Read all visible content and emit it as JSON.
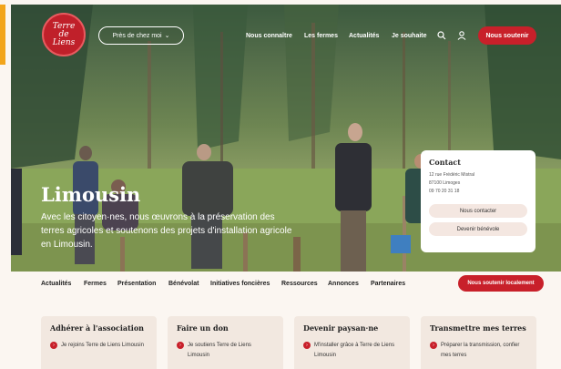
{
  "brand": {
    "logo_line1": "Terre",
    "logo_line2": "de",
    "logo_line3": "Liens",
    "accent": "#c8202a"
  },
  "header": {
    "near_me_label": "Près de chez moi",
    "nav": [
      "Nous connaître",
      "Les fermes",
      "Actualités",
      "Je souhaite"
    ],
    "support_label": "Nous soutenir",
    "icons": [
      "search-icon",
      "user-icon"
    ]
  },
  "hero": {
    "title": "Limousin",
    "text": "Avec les citoyen·nes, nous œuvrons à la préservation des terres agricoles et soutenons des projets d'installation agricole en Limousin."
  },
  "contact": {
    "title": "Contact",
    "address1": "12 rue Frédéric Mistral",
    "address2": "87100 Limoges",
    "phone": "09 70 20 31 18",
    "contact_btn": "Nous contacter",
    "volunteer_btn": "Devenir bénévole"
  },
  "subnav": {
    "items": [
      "Actualités",
      "Fermes",
      "Présentation",
      "Bénévolat",
      "Initiatives foncières",
      "Ressources",
      "Annonces",
      "Partenaires"
    ],
    "support_local_label": "Nous soutenir localement"
  },
  "cards": [
    {
      "title": "Adhérer à l'association",
      "link": "Je rejoins Terre de Liens Limousin"
    },
    {
      "title": "Faire un don",
      "link": "Je soutiens Terre de Liens Limousin"
    },
    {
      "title": "Devenir paysan·ne",
      "link": "M'installer grâce à Terre de Liens Limousin"
    },
    {
      "title": "Transmettre mes terres",
      "link": "Préparer la transmission, confier mes terres"
    }
  ]
}
